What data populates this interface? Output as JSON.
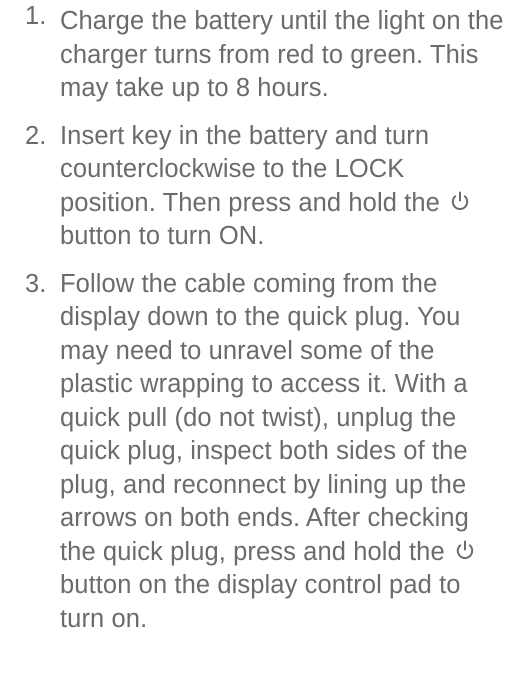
{
  "steps": [
    {
      "number": "1.",
      "text": "Charge the battery until the light on the charger turns from red to green. This may take up to 8 hours."
    },
    {
      "number": "2.",
      "text_before_icon": "Insert key in the battery and turn counterclockwise to the LOCK position. Then press and hold the",
      "icon": "power-icon",
      "text_after_icon": "button to turn ON."
    },
    {
      "number": "3.",
      "text_before_icon": "Follow the cable coming from the display down to the quick plug. You may need to unravel some of the plastic wrapping to access it. With a quick pull (do not twist), unplug the quick plug, inspect both sides of the plug, and reconnect by lining up the arrows on both ends. After checking the quick plug, press and hold the",
      "icon": "power-icon",
      "text_after_icon": "button on the display control pad to turn on."
    }
  ]
}
